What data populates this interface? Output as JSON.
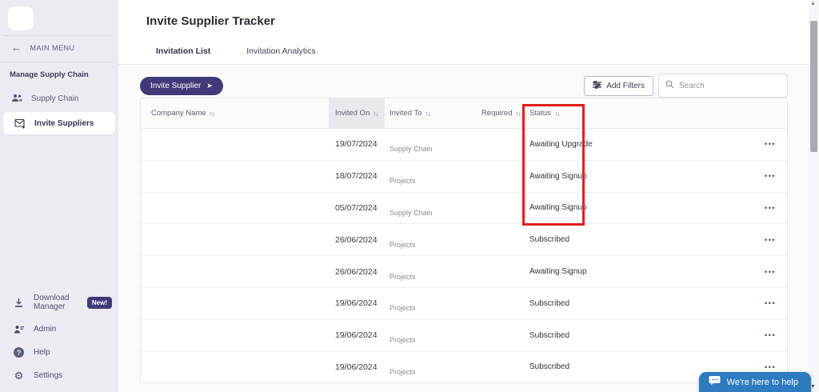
{
  "sidebar": {
    "main_menu_label": "MAIN MENU",
    "section_label": "Manage Supply Chain",
    "items": [
      {
        "label": "Supply Chain",
        "active": false
      },
      {
        "label": "Invite Suppliers",
        "active": true
      }
    ],
    "bottom_items": [
      {
        "label": "Download Manager",
        "badge": "New!"
      },
      {
        "label": "Admin"
      },
      {
        "label": "Help"
      },
      {
        "label": "Settings"
      }
    ],
    "help_glyph": "?",
    "gear_glyph": "⚙"
  },
  "header": {
    "title": "Invite Supplier Tracker",
    "tabs": [
      {
        "label": "Invitation List",
        "active": true
      },
      {
        "label": "Invitation Analytics",
        "active": false
      }
    ]
  },
  "toolbar": {
    "invite_button_label": "Invite Supplier",
    "invite_button_arrow": "➤",
    "add_filters_label": "Add Filters",
    "search_placeholder": "Search"
  },
  "table": {
    "columns": [
      "Company Name",
      "Invited On",
      "Invited To",
      "Required",
      "Status"
    ],
    "sort_icon": "↑↓",
    "actions_icon": "•••",
    "rows": [
      {
        "company": "",
        "invited_on": "19/07/2024",
        "invited_to": "Supply Chain",
        "required": "",
        "status": "Awaiting Upgrade"
      },
      {
        "company": "",
        "invited_on": "18/07/2024",
        "invited_to": "Projects",
        "required": "",
        "status": "Awaiting Signup"
      },
      {
        "company": "",
        "invited_on": "05/07/2024",
        "invited_to": "Supply Chain",
        "required": "",
        "status": "Awaiting Signup"
      },
      {
        "company": "",
        "invited_on": "26/06/2024",
        "invited_to": "Projects",
        "required": "",
        "status": "Subscribed"
      },
      {
        "company": "",
        "invited_on": "26/06/2024",
        "invited_to": "Projects",
        "required": "",
        "status": "Awaiting Signup"
      },
      {
        "company": "",
        "invited_on": "19/06/2024",
        "invited_to": "Projects",
        "required": "",
        "status": "Subscribed"
      },
      {
        "company": "",
        "invited_on": "19/06/2024",
        "invited_to": "Projects",
        "required": "",
        "status": "Subscribed"
      },
      {
        "company": "",
        "invited_on": "19/06/2024",
        "invited_to": "Projects",
        "required": "",
        "status": "Subscribed"
      }
    ]
  },
  "chat": {
    "label": "We're here to help"
  },
  "scrollbar": {
    "up_glyph": "▲",
    "down_glyph": "▼"
  },
  "colors": {
    "brand": "#403a78",
    "highlight_red": "#e51c1c",
    "chat_blue": "#2e7bc0",
    "sidebar_bg": "#ecebf2"
  }
}
